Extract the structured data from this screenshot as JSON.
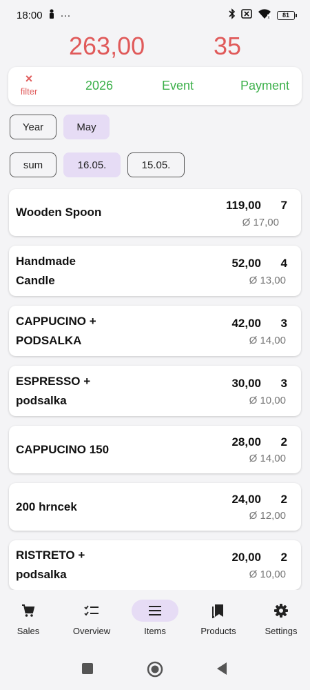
{
  "status": {
    "time": "18:00",
    "more": "···",
    "battery": "81"
  },
  "totals": {
    "sum": "263,00",
    "count": "35"
  },
  "filterbar": {
    "filter_icon": "×",
    "filter_label": "filter",
    "year": "2026",
    "event": "Event",
    "payment": "Payment"
  },
  "chips_row1": {
    "year": "Year",
    "month": "May"
  },
  "chips_row2": {
    "sum": "sum",
    "date1": "16.05.",
    "date2": "15.05."
  },
  "items": [
    {
      "name": "Wooden Spoon",
      "sum": "119,00",
      "qty": "7",
      "avg": "Ø 17,00"
    },
    {
      "name": " Handmade\nCandle",
      "sum": "52,00",
      "qty": "4",
      "avg": "Ø 13,00"
    },
    {
      "name": "CAPPUCINO +\nPODSALKA",
      "sum": "42,00",
      "qty": "3",
      "avg": "Ø 14,00"
    },
    {
      "name": "ESPRESSO +\npodsalka",
      "sum": "30,00",
      "qty": "3",
      "avg": "Ø 10,00"
    },
    {
      "name": "CAPPUCINO 150",
      "sum": "28,00",
      "qty": "2",
      "avg": "Ø 14,00"
    },
    {
      "name": "200 hrncek",
      "sum": "24,00",
      "qty": "2",
      "avg": "Ø 12,00"
    },
    {
      "name": "RISTRETO +\npodsalka",
      "sum": "20,00",
      "qty": "2",
      "avg": "Ø 10,00"
    }
  ],
  "nav": {
    "sales": "Sales",
    "overview": "Overview",
    "items": "Items",
    "products": "Products",
    "settings": "Settings"
  },
  "colors": {
    "accent_red": "#e05a5a",
    "accent_green": "#3cb04a",
    "selected_chip": "#e6dcf5"
  }
}
